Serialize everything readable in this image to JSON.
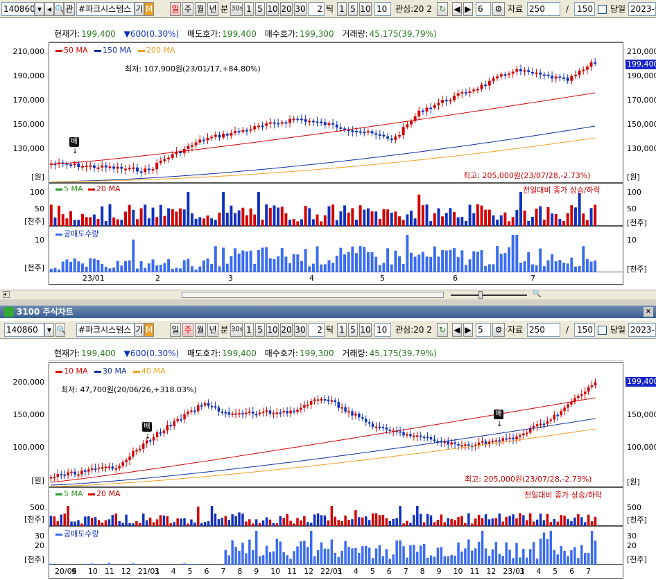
{
  "top": {
    "toolbar": {
      "code": "140860",
      "chart_btn": "관",
      "name": "#파크시스템스",
      "gi": "기",
      "m": "M",
      "periods": [
        "일",
        "주",
        "월",
        "년",
        "분",
        "30s",
        "1",
        "5",
        "10",
        "20",
        "30"
      ],
      "tick_value": "2",
      "tick_label": "틱",
      "ticks": [
        "1",
        "5",
        "10",
        "10"
      ],
      "watch": "관심:20 2",
      "count": "6",
      "data_label": "자료",
      "data_value": "250",
      "slash": "/",
      "limit": "150",
      "today": "당일",
      "date": "2023-0"
    },
    "info": {
      "cur_label": "현재가:",
      "cur_value": "199,400",
      "chg": "▼600(0.30%)",
      "ask_label": "매도호가:",
      "ask_value": "199,400",
      "bid_label": "매수호가:",
      "bid_value": "199,300",
      "vol_label": "거래량:",
      "vol_value": "45,175(39.79%)"
    },
    "legend": [
      "50 MA",
      "150 MA",
      "200 MA"
    ],
    "legend_colors": [
      "#d40000",
      "#1030a0",
      "#f0a020"
    ],
    "low_note": "최저: 107,900원(23/01/17,+84.80%)",
    "high_note": "최고: 205,000원(23/07/28,-2.73%)",
    "price_tag": "199,400",
    "y_ticks": [
      "210,000",
      "190,000",
      "170,000",
      "150,000",
      "130,000"
    ],
    "unit": "[원]",
    "vol_legend": [
      "5 MA",
      "20 MA"
    ],
    "vol_note": "전일대비 종가 상승/하락",
    "vol_ticks": [
      "100",
      "50"
    ],
    "vol_unit": "[천주]",
    "short_label": "공매도수량",
    "short_ticks": [
      "10"
    ],
    "short_unit": "[천주]",
    "x_ticks": [
      "23/01",
      "2",
      "3",
      "4",
      "5",
      "6",
      "7"
    ],
    "marker": "배"
  },
  "bottom": {
    "title": "3100 주식차트",
    "toolbar": {
      "code": "140860",
      "name": "#파크시스템스",
      "gi": "기",
      "m": "M",
      "periods": [
        "일",
        "주",
        "월",
        "년",
        "분",
        "30s",
        "1",
        "5",
        "10",
        "20",
        "30"
      ],
      "tick_value": "2",
      "tick_label": "틱",
      "ticks": [
        "1",
        "5",
        "10",
        "10"
      ],
      "watch": "관심:20 2",
      "count": "5",
      "data_label": "자료",
      "data_value": "250",
      "slash": "/",
      "limit": "150",
      "today": "당일",
      "date": "2023-0"
    },
    "info": {
      "cur_label": "현재가:",
      "cur_value": "199,400",
      "chg": "▼600(0.30%)",
      "ask_label": "매도호가:",
      "ask_value": "199,400",
      "bid_label": "매수호가:",
      "bid_value": "199,300",
      "vol_label": "거래량:",
      "vol_value": "45,175(39.79%)"
    },
    "legend": [
      "10 MA",
      "30 MA",
      "40 MA"
    ],
    "legend_colors": [
      "#d40000",
      "#1030a0",
      "#f0a020"
    ],
    "low_note": "최저: 47,700원(20/06/26,+318.03%)",
    "high_note": "최고: 205,000원(23/07/28,-2.73%)",
    "price_tag": "199,400",
    "y_ticks": [
      "200,000",
      "150,000",
      "100,000"
    ],
    "unit": "[원]",
    "vol_legend": [
      "5 MA",
      "20 MA"
    ],
    "vol_note": "전일대비 종가 상승/하락",
    "vol_ticks": [
      "500",
      "500"
    ],
    "vol_unit": "[천주]",
    "short_label": "공매도수량",
    "short_ticks": [
      "30",
      "20"
    ],
    "short_unit": "[천주]",
    "x_ticks": [
      "20/06",
      "9",
      "10",
      "11",
      "12",
      "21/01",
      "3",
      "4",
      "5",
      "6",
      "7",
      "8",
      "9",
      "10",
      "11",
      "12",
      "22/01",
      "3",
      "4",
      "5",
      "6",
      "7",
      "8",
      "9",
      "10",
      "11",
      "12",
      "23/01",
      "3",
      "4",
      "5",
      "6",
      "7"
    ],
    "marker": "배"
  },
  "colors": {
    "up": "#d40000",
    "down": "#1030c0",
    "short": "#3a6cf0",
    "tag": "#1726cc"
  }
}
